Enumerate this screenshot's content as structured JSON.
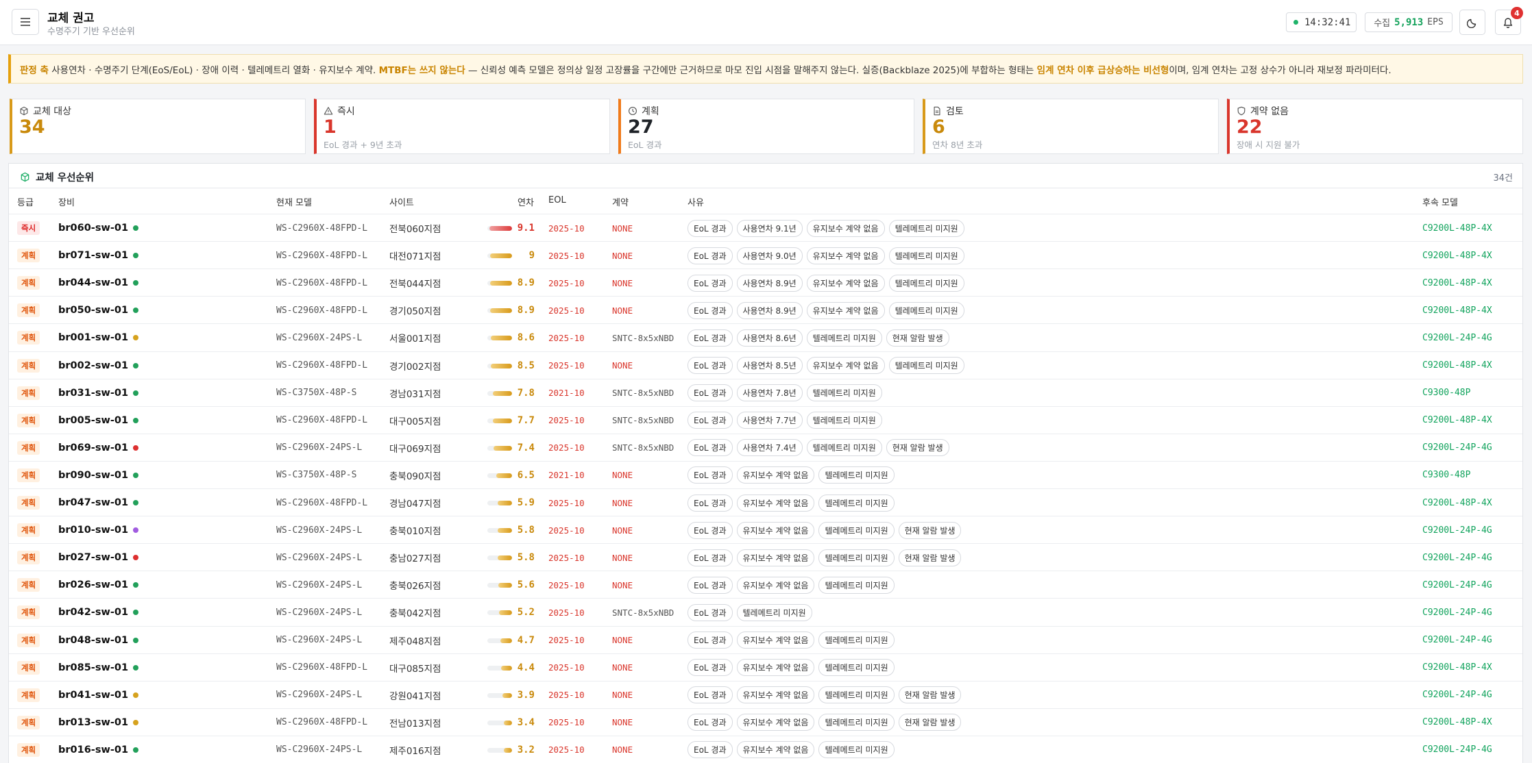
{
  "header": {
    "title": "교체 권고",
    "subtitle": "수명주기 기반 우선순위",
    "clock": "14:32:41",
    "eps_label": "수집",
    "eps_value": "5,913",
    "eps_unit": "EPS",
    "notification_count": "4"
  },
  "notice": {
    "lead": "판정 축",
    "text1": " 사용연차 · 수명주기 단계(EoS/EoL) · 장애 이력 · 텔레메트리 열화 · 유지보수 계약. ",
    "mtbf": "MTBF는 쓰지 않는다",
    "text2": " — 신뢰성 예측 모델은 정의상 일정 고장률을 구간에만 근거하므로 마모 진입 시점을 말해주지 않는다. 실증(Backblaze 2025)에 부합하는 형태는 ",
    "nonlinear": "임계 연차 이후 급상승하는 비선형",
    "text3": "이며, 임계 연차는 고정 상수가 아니라 재보정 파라미터다."
  },
  "kpis": [
    {
      "label": "교체 대상",
      "value": "34",
      "note": "",
      "icon": "cube-icon",
      "color": "#d89a1a",
      "value_color": "#c98a0c"
    },
    {
      "label": "즉시",
      "value": "1",
      "note": "EoL 경과 + 9년 초과",
      "icon": "alert-triangle-icon",
      "color": "#d9362c",
      "value_color": "#d9362c"
    },
    {
      "label": "계획",
      "value": "27",
      "note": "EoL 경과",
      "icon": "clock-icon",
      "color": "#f07a1a",
      "value_color": "#1f2328"
    },
    {
      "label": "검토",
      "value": "6",
      "note": "연차 8년 초과",
      "icon": "document-icon",
      "color": "#d89a1a",
      "value_color": "#c98a0c"
    },
    {
      "label": "계약 없음",
      "value": "22",
      "note": "장애 시 지원 불가",
      "icon": "shield-icon",
      "color": "#d9362c",
      "value_color": "#d9362c"
    }
  ],
  "table": {
    "title": "교체 우선순위",
    "count": "34건",
    "columns": {
      "grade": "등급",
      "device": "장비",
      "model": "현재 모델",
      "site": "사이트",
      "age": "연차",
      "eol": "EOL",
      "contract": "계약",
      "reason": "사유",
      "successor": "후속 모델"
    },
    "rows": [
      {
        "grade": "즉시",
        "grade_type": "now",
        "device": "br060-sw-01",
        "status": "#22a05a",
        "model": "WS-C2960X-48FPD-L",
        "site": "전북060지점",
        "age": "9.1",
        "age_num": 9.1,
        "eol": "2025-10",
        "contract": "NONE",
        "tags": [
          "EoL 경과",
          "사용연차 9.1년",
          "유지보수 계약 없음",
          "텔레메트리 미지원"
        ],
        "successor": "C9200L-48P-4X"
      },
      {
        "grade": "계획",
        "grade_type": "plan",
        "device": "br071-sw-01",
        "status": "#22a05a",
        "model": "WS-C2960X-48FPD-L",
        "site": "대전071지점",
        "age": "9",
        "age_num": 9.0,
        "eol": "2025-10",
        "contract": "NONE",
        "tags": [
          "EoL 경과",
          "사용연차 9.0년",
          "유지보수 계약 없음",
          "텔레메트리 미지원"
        ],
        "successor": "C9200L-48P-4X"
      },
      {
        "grade": "계획",
        "grade_type": "plan",
        "device": "br044-sw-01",
        "status": "#22a05a",
        "model": "WS-C2960X-48FPD-L",
        "site": "전북044지점",
        "age": "8.9",
        "age_num": 8.9,
        "eol": "2025-10",
        "contract": "NONE",
        "tags": [
          "EoL 경과",
          "사용연차 8.9년",
          "유지보수 계약 없음",
          "텔레메트리 미지원"
        ],
        "successor": "C9200L-48P-4X"
      },
      {
        "grade": "계획",
        "grade_type": "plan",
        "device": "br050-sw-01",
        "status": "#22a05a",
        "model": "WS-C2960X-48FPD-L",
        "site": "경기050지점",
        "age": "8.9",
        "age_num": 8.9,
        "eol": "2025-10",
        "contract": "NONE",
        "tags": [
          "EoL 경과",
          "사용연차 8.9년",
          "유지보수 계약 없음",
          "텔레메트리 미지원"
        ],
        "successor": "C9200L-48P-4X"
      },
      {
        "grade": "계획",
        "grade_type": "plan",
        "device": "br001-sw-01",
        "status": "#d6a21e",
        "model": "WS-C2960X-24PS-L",
        "site": "서울001지점",
        "age": "8.6",
        "age_num": 8.6,
        "eol": "2025-10",
        "contract": "SNTC-8x5xNBD",
        "tags": [
          "EoL 경과",
          "사용연차 8.6년",
          "텔레메트리 미지원",
          "현재 알람 발생"
        ],
        "successor": "C9200L-24P-4G"
      },
      {
        "grade": "계획",
        "grade_type": "plan",
        "device": "br002-sw-01",
        "status": "#22a05a",
        "model": "WS-C2960X-48FPD-L",
        "site": "경기002지점",
        "age": "8.5",
        "age_num": 8.5,
        "eol": "2025-10",
        "contract": "NONE",
        "tags": [
          "EoL 경과",
          "사용연차 8.5년",
          "유지보수 계약 없음",
          "텔레메트리 미지원"
        ],
        "successor": "C9200L-48P-4X"
      },
      {
        "grade": "계획",
        "grade_type": "plan",
        "device": "br031-sw-01",
        "status": "#22a05a",
        "model": "WS-C3750X-48P-S",
        "site": "경남031지점",
        "age": "7.8",
        "age_num": 7.8,
        "eol": "2021-10",
        "contract": "SNTC-8x5xNBD",
        "tags": [
          "EoL 경과",
          "사용연차 7.8년",
          "텔레메트리 미지원"
        ],
        "successor": "C9300-48P"
      },
      {
        "grade": "계획",
        "grade_type": "plan",
        "device": "br005-sw-01",
        "status": "#22a05a",
        "model": "WS-C2960X-48FPD-L",
        "site": "대구005지점",
        "age": "7.7",
        "age_num": 7.7,
        "eol": "2025-10",
        "contract": "SNTC-8x5xNBD",
        "tags": [
          "EoL 경과",
          "사용연차 7.7년",
          "텔레메트리 미지원"
        ],
        "successor": "C9200L-48P-4X"
      },
      {
        "grade": "계획",
        "grade_type": "plan",
        "device": "br069-sw-01",
        "status": "#dd3030",
        "model": "WS-C2960X-24PS-L",
        "site": "대구069지점",
        "age": "7.4",
        "age_num": 7.4,
        "eol": "2025-10",
        "contract": "SNTC-8x5xNBD",
        "tags": [
          "EoL 경과",
          "사용연차 7.4년",
          "텔레메트리 미지원",
          "현재 알람 발생"
        ],
        "successor": "C9200L-24P-4G"
      },
      {
        "grade": "계획",
        "grade_type": "plan",
        "device": "br090-sw-01",
        "status": "#22a05a",
        "model": "WS-C3750X-48P-S",
        "site": "충북090지점",
        "age": "6.5",
        "age_num": 6.5,
        "eol": "2021-10",
        "contract": "NONE",
        "tags": [
          "EoL 경과",
          "유지보수 계약 없음",
          "텔레메트리 미지원"
        ],
        "successor": "C9300-48P"
      },
      {
        "grade": "계획",
        "grade_type": "plan",
        "device": "br047-sw-01",
        "status": "#22a05a",
        "model": "WS-C2960X-48FPD-L",
        "site": "경남047지점",
        "age": "5.9",
        "age_num": 5.9,
        "eol": "2025-10",
        "contract": "NONE",
        "tags": [
          "EoL 경과",
          "유지보수 계약 없음",
          "텔레메트리 미지원"
        ],
        "successor": "C9200L-48P-4X"
      },
      {
        "grade": "계획",
        "grade_type": "plan",
        "device": "br010-sw-01",
        "status": "#a15ce0",
        "model": "WS-C2960X-24PS-L",
        "site": "충북010지점",
        "age": "5.8",
        "age_num": 5.8,
        "eol": "2025-10",
        "contract": "NONE",
        "tags": [
          "EoL 경과",
          "유지보수 계약 없음",
          "텔레메트리 미지원",
          "현재 알람 발생"
        ],
        "successor": "C9200L-24P-4G"
      },
      {
        "grade": "계획",
        "grade_type": "plan",
        "device": "br027-sw-01",
        "status": "#dd3030",
        "model": "WS-C2960X-24PS-L",
        "site": "충남027지점",
        "age": "5.8",
        "age_num": 5.8,
        "eol": "2025-10",
        "contract": "NONE",
        "tags": [
          "EoL 경과",
          "유지보수 계약 없음",
          "텔레메트리 미지원",
          "현재 알람 발생"
        ],
        "successor": "C9200L-24P-4G"
      },
      {
        "grade": "계획",
        "grade_type": "plan",
        "device": "br026-sw-01",
        "status": "#22a05a",
        "model": "WS-C2960X-24PS-L",
        "site": "충북026지점",
        "age": "5.6",
        "age_num": 5.6,
        "eol": "2025-10",
        "contract": "NONE",
        "tags": [
          "EoL 경과",
          "유지보수 계약 없음",
          "텔레메트리 미지원"
        ],
        "successor": "C9200L-24P-4G"
      },
      {
        "grade": "계획",
        "grade_type": "plan",
        "device": "br042-sw-01",
        "status": "#22a05a",
        "model": "WS-C2960X-24PS-L",
        "site": "충북042지점",
        "age": "5.2",
        "age_num": 5.2,
        "eol": "2025-10",
        "contract": "SNTC-8x5xNBD",
        "tags": [
          "EoL 경과",
          "텔레메트리 미지원"
        ],
        "successor": "C9200L-24P-4G"
      },
      {
        "grade": "계획",
        "grade_type": "plan",
        "device": "br048-sw-01",
        "status": "#22a05a",
        "model": "WS-C2960X-24PS-L",
        "site": "제주048지점",
        "age": "4.7",
        "age_num": 4.7,
        "eol": "2025-10",
        "contract": "NONE",
        "tags": [
          "EoL 경과",
          "유지보수 계약 없음",
          "텔레메트리 미지원"
        ],
        "successor": "C9200L-24P-4G"
      },
      {
        "grade": "계획",
        "grade_type": "plan",
        "device": "br085-sw-01",
        "status": "#22a05a",
        "model": "WS-C2960X-48FPD-L",
        "site": "대구085지점",
        "age": "4.4",
        "age_num": 4.4,
        "eol": "2025-10",
        "contract": "NONE",
        "tags": [
          "EoL 경과",
          "유지보수 계약 없음",
          "텔레메트리 미지원"
        ],
        "successor": "C9200L-48P-4X"
      },
      {
        "grade": "계획",
        "grade_type": "plan",
        "device": "br041-sw-01",
        "status": "#d6a21e",
        "model": "WS-C2960X-24PS-L",
        "site": "강원041지점",
        "age": "3.9",
        "age_num": 3.9,
        "eol": "2025-10",
        "contract": "NONE",
        "tags": [
          "EoL 경과",
          "유지보수 계약 없음",
          "텔레메트리 미지원",
          "현재 알람 발생"
        ],
        "successor": "C9200L-24P-4G"
      },
      {
        "grade": "계획",
        "grade_type": "plan",
        "device": "br013-sw-01",
        "status": "#d6a21e",
        "model": "WS-C2960X-48FPD-L",
        "site": "전남013지점",
        "age": "3.4",
        "age_num": 3.4,
        "eol": "2025-10",
        "contract": "NONE",
        "tags": [
          "EoL 경과",
          "유지보수 계약 없음",
          "텔레메트리 미지원",
          "현재 알람 발생"
        ],
        "successor": "C9200L-48P-4X"
      },
      {
        "grade": "계획",
        "grade_type": "plan",
        "device": "br016-sw-01",
        "status": "#22a05a",
        "model": "WS-C2960X-24PS-L",
        "site": "제주016지점",
        "age": "3.2",
        "age_num": 3.2,
        "eol": "2025-10",
        "contract": "NONE",
        "tags": [
          "EoL 경과",
          "유지보수 계약 없음",
          "텔레메트리 미지원"
        ],
        "successor": "C9200L-24P-4G"
      }
    ]
  }
}
